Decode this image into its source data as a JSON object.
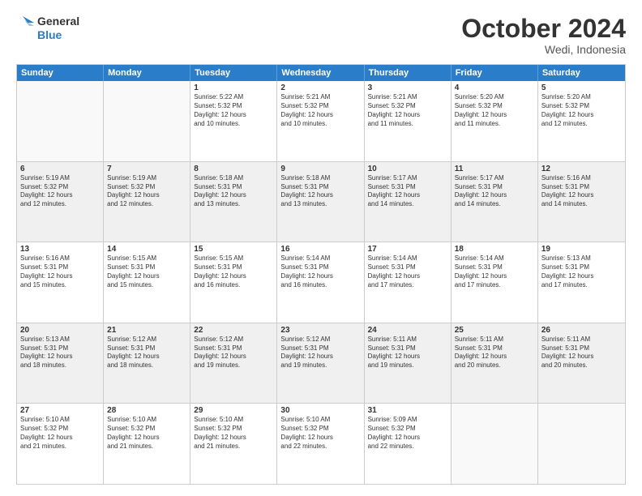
{
  "logo": {
    "line1": "General",
    "line2": "Blue"
  },
  "title": "October 2024",
  "location": "Wedi, Indonesia",
  "days": [
    "Sunday",
    "Monday",
    "Tuesday",
    "Wednesday",
    "Thursday",
    "Friday",
    "Saturday"
  ],
  "rows": [
    [
      {
        "day": "",
        "text": "",
        "empty": true
      },
      {
        "day": "",
        "text": "",
        "empty": true
      },
      {
        "day": "1",
        "text": "Sunrise: 5:22 AM\nSunset: 5:32 PM\nDaylight: 12 hours\nand 10 minutes."
      },
      {
        "day": "2",
        "text": "Sunrise: 5:21 AM\nSunset: 5:32 PM\nDaylight: 12 hours\nand 10 minutes."
      },
      {
        "day": "3",
        "text": "Sunrise: 5:21 AM\nSunset: 5:32 PM\nDaylight: 12 hours\nand 11 minutes."
      },
      {
        "day": "4",
        "text": "Sunrise: 5:20 AM\nSunset: 5:32 PM\nDaylight: 12 hours\nand 11 minutes."
      },
      {
        "day": "5",
        "text": "Sunrise: 5:20 AM\nSunset: 5:32 PM\nDaylight: 12 hours\nand 12 minutes."
      }
    ],
    [
      {
        "day": "6",
        "text": "Sunrise: 5:19 AM\nSunset: 5:32 PM\nDaylight: 12 hours\nand 12 minutes."
      },
      {
        "day": "7",
        "text": "Sunrise: 5:19 AM\nSunset: 5:32 PM\nDaylight: 12 hours\nand 12 minutes."
      },
      {
        "day": "8",
        "text": "Sunrise: 5:18 AM\nSunset: 5:31 PM\nDaylight: 12 hours\nand 13 minutes."
      },
      {
        "day": "9",
        "text": "Sunrise: 5:18 AM\nSunset: 5:31 PM\nDaylight: 12 hours\nand 13 minutes."
      },
      {
        "day": "10",
        "text": "Sunrise: 5:17 AM\nSunset: 5:31 PM\nDaylight: 12 hours\nand 14 minutes."
      },
      {
        "day": "11",
        "text": "Sunrise: 5:17 AM\nSunset: 5:31 PM\nDaylight: 12 hours\nand 14 minutes."
      },
      {
        "day": "12",
        "text": "Sunrise: 5:16 AM\nSunset: 5:31 PM\nDaylight: 12 hours\nand 14 minutes."
      }
    ],
    [
      {
        "day": "13",
        "text": "Sunrise: 5:16 AM\nSunset: 5:31 PM\nDaylight: 12 hours\nand 15 minutes."
      },
      {
        "day": "14",
        "text": "Sunrise: 5:15 AM\nSunset: 5:31 PM\nDaylight: 12 hours\nand 15 minutes."
      },
      {
        "day": "15",
        "text": "Sunrise: 5:15 AM\nSunset: 5:31 PM\nDaylight: 12 hours\nand 16 minutes."
      },
      {
        "day": "16",
        "text": "Sunrise: 5:14 AM\nSunset: 5:31 PM\nDaylight: 12 hours\nand 16 minutes."
      },
      {
        "day": "17",
        "text": "Sunrise: 5:14 AM\nSunset: 5:31 PM\nDaylight: 12 hours\nand 17 minutes."
      },
      {
        "day": "18",
        "text": "Sunrise: 5:14 AM\nSunset: 5:31 PM\nDaylight: 12 hours\nand 17 minutes."
      },
      {
        "day": "19",
        "text": "Sunrise: 5:13 AM\nSunset: 5:31 PM\nDaylight: 12 hours\nand 17 minutes."
      }
    ],
    [
      {
        "day": "20",
        "text": "Sunrise: 5:13 AM\nSunset: 5:31 PM\nDaylight: 12 hours\nand 18 minutes."
      },
      {
        "day": "21",
        "text": "Sunrise: 5:12 AM\nSunset: 5:31 PM\nDaylight: 12 hours\nand 18 minutes."
      },
      {
        "day": "22",
        "text": "Sunrise: 5:12 AM\nSunset: 5:31 PM\nDaylight: 12 hours\nand 19 minutes."
      },
      {
        "day": "23",
        "text": "Sunrise: 5:12 AM\nSunset: 5:31 PM\nDaylight: 12 hours\nand 19 minutes."
      },
      {
        "day": "24",
        "text": "Sunrise: 5:11 AM\nSunset: 5:31 PM\nDaylight: 12 hours\nand 19 minutes."
      },
      {
        "day": "25",
        "text": "Sunrise: 5:11 AM\nSunset: 5:31 PM\nDaylight: 12 hours\nand 20 minutes."
      },
      {
        "day": "26",
        "text": "Sunrise: 5:11 AM\nSunset: 5:31 PM\nDaylight: 12 hours\nand 20 minutes."
      }
    ],
    [
      {
        "day": "27",
        "text": "Sunrise: 5:10 AM\nSunset: 5:32 PM\nDaylight: 12 hours\nand 21 minutes."
      },
      {
        "day": "28",
        "text": "Sunrise: 5:10 AM\nSunset: 5:32 PM\nDaylight: 12 hours\nand 21 minutes."
      },
      {
        "day": "29",
        "text": "Sunrise: 5:10 AM\nSunset: 5:32 PM\nDaylight: 12 hours\nand 21 minutes."
      },
      {
        "day": "30",
        "text": "Sunrise: 5:10 AM\nSunset: 5:32 PM\nDaylight: 12 hours\nand 22 minutes."
      },
      {
        "day": "31",
        "text": "Sunrise: 5:09 AM\nSunset: 5:32 PM\nDaylight: 12 hours\nand 22 minutes."
      },
      {
        "day": "",
        "text": "",
        "empty": true
      },
      {
        "day": "",
        "text": "",
        "empty": true
      }
    ]
  ]
}
